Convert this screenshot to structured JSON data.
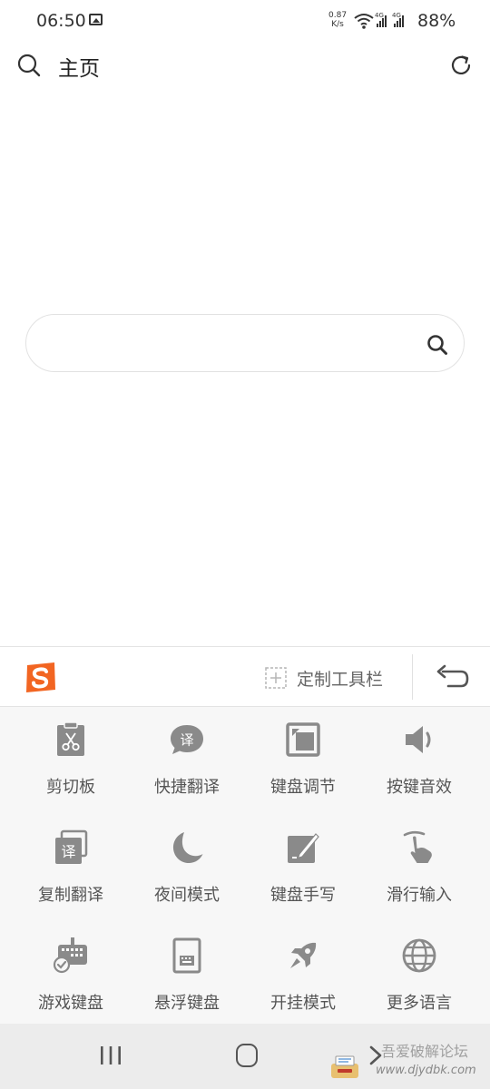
{
  "status_bar": {
    "time": "06:50",
    "net_speed_value": "0.87",
    "net_speed_unit": "K/s",
    "network_label": "4G",
    "battery": "88%"
  },
  "header": {
    "title": "主页"
  },
  "search": {
    "value": "",
    "placeholder": ""
  },
  "keyboard": {
    "customize_label": "定制工具栏",
    "tools": [
      {
        "label": "剪切板",
        "icon": "clipboard-scissors-icon"
      },
      {
        "label": "快捷翻译",
        "icon": "translate-bubble-icon"
      },
      {
        "label": "键盘调节",
        "icon": "keyboard-resize-icon"
      },
      {
        "label": "按键音效",
        "icon": "speaker-icon"
      },
      {
        "label": "复制翻译",
        "icon": "copy-translate-icon"
      },
      {
        "label": "夜间模式",
        "icon": "moon-icon"
      },
      {
        "label": "键盘手写",
        "icon": "handwriting-icon"
      },
      {
        "label": "滑行输入",
        "icon": "swipe-hand-icon"
      },
      {
        "label": "游戏键盘",
        "icon": "game-keyboard-icon"
      },
      {
        "label": "悬浮键盘",
        "icon": "floating-keyboard-icon"
      },
      {
        "label": "开挂模式",
        "icon": "rocket-icon"
      },
      {
        "label": "更多语言",
        "icon": "globe-icon"
      }
    ],
    "translate_glyph": "译"
  },
  "watermark": {
    "main": "吾爱破解论坛",
    "sub": "www.djydbk.com"
  },
  "colors": {
    "sogou_orange": "#f26522",
    "icon_gray": "#8a8a8a",
    "panel_bg": "#f7f7f7"
  }
}
